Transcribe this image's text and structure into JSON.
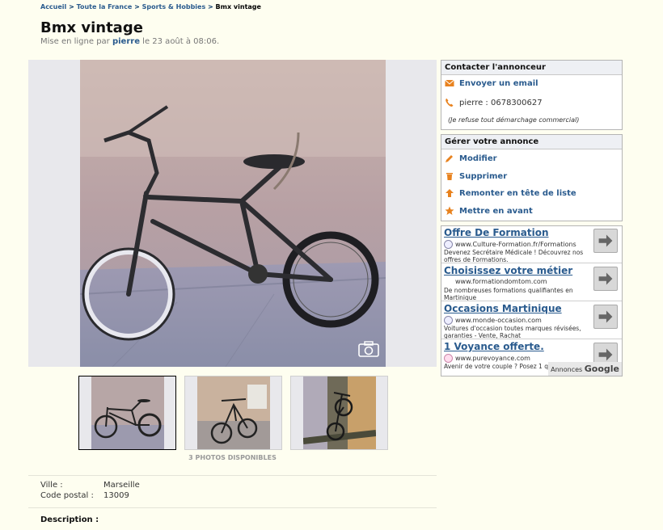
{
  "breadcrumb": {
    "items": [
      "Accueil",
      "Toute la France",
      "Sports & Hobbies"
    ],
    "sep": ">",
    "current": "Bmx vintage"
  },
  "ad": {
    "title": "Bmx vintage",
    "posted_prefix": "Mise en ligne par",
    "author": "pierre",
    "posted_suffix": "le 23 août à 08:06."
  },
  "photos": {
    "count_label": "3 PHOTOS DISPONIBLES",
    "camera_icon": "camera-icon"
  },
  "details": {
    "city_label": "Ville :",
    "city": "Marseille",
    "zip_label": "Code postal :",
    "zip": "13009",
    "description_label": "Description :"
  },
  "contact": {
    "header": "Contacter l'annonceur",
    "email_label": "Envoyer un email",
    "phone_text": "pierre : 0678300627",
    "refuse_text": "(Je refuse tout démarchage commercial)"
  },
  "manage": {
    "header": "Gérer votre annonce",
    "edit": "Modifier",
    "delete": "Supprimer",
    "bump": "Remonter en tête de liste",
    "feature": "Mettre en avant"
  },
  "google_ads": {
    "badge_prefix": "Annonces",
    "badge_brand": "Google",
    "items": [
      {
        "title": "Offre De Formation",
        "url": "www.Culture-Formation.fr/Formations",
        "desc": "Devenez Secrétaire Médicale ! Découvrez nos offres de Formations."
      },
      {
        "title": "Choisissez votre métier",
        "url": "www.formationdomtom.com",
        "desc": "De nombreuses formations qualifiantes en Martinique"
      },
      {
        "title": "Occasions Martinique",
        "url": "www.monde-occasion.com",
        "desc": "Voitures d'occasion toutes marques révisées, garanties - Vente, Rachat"
      },
      {
        "title": "1 Voyance offerte.",
        "url": "www.purevoyance.com",
        "desc": "Avenir de votre couple ? Posez 1 qu"
      }
    ]
  },
  "colors": {
    "background": "#fefef0",
    "link": "#2a5b8e",
    "icon_orange": "#e8821e"
  }
}
